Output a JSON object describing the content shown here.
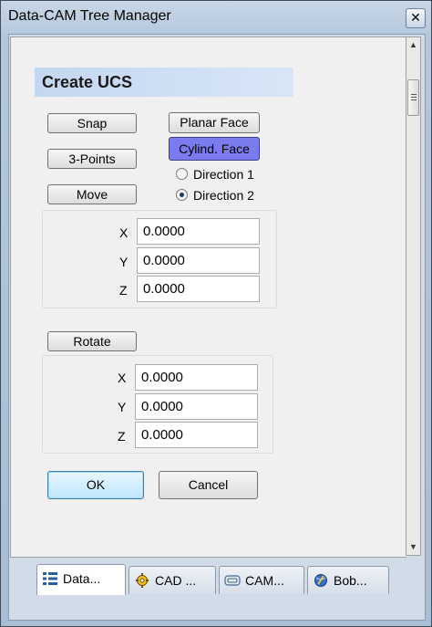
{
  "window": {
    "title": "Data-CAM Tree Manager",
    "close_glyph": "✕"
  },
  "panel": {
    "heading": "Create UCS"
  },
  "buttons": {
    "snap": "Snap",
    "three_points": "3-Points",
    "move": "Move",
    "planar_face": "Planar Face",
    "cylind_face": "Cylind. Face",
    "rotate": "Rotate",
    "ok": "OK",
    "cancel": "Cancel"
  },
  "radios": [
    {
      "label": "Direction 1",
      "checked": false
    },
    {
      "label": "Direction 2",
      "checked": true
    }
  ],
  "move_coords": {
    "x_label": "X",
    "x_value": "0.0000",
    "y_label": "Y",
    "y_value": "0.0000",
    "z_label": "Z",
    "z_value": "0.0000"
  },
  "rotate_coords": {
    "x_label": "X",
    "x_value": "0.0000",
    "y_label": "Y",
    "y_value": "0.0000",
    "z_label": "Z",
    "z_value": "0.0000"
  },
  "scrollbar": {
    "up_glyph": "▲",
    "down_glyph": "▼"
  },
  "tabs": [
    {
      "label": "Data...",
      "icon": "tree-list-icon",
      "active": true
    },
    {
      "label": "CAD ...",
      "icon": "gear-icon",
      "active": false
    },
    {
      "label": "CAM...",
      "icon": "cam-icon",
      "active": false
    },
    {
      "label": "Bob...",
      "icon": "bob-globe-icon",
      "active": false
    }
  ],
  "colors": {
    "selected_button": "#7b7bf0",
    "heading_bar": "#c4d7f0",
    "window_frame": "#b4c7dc"
  }
}
